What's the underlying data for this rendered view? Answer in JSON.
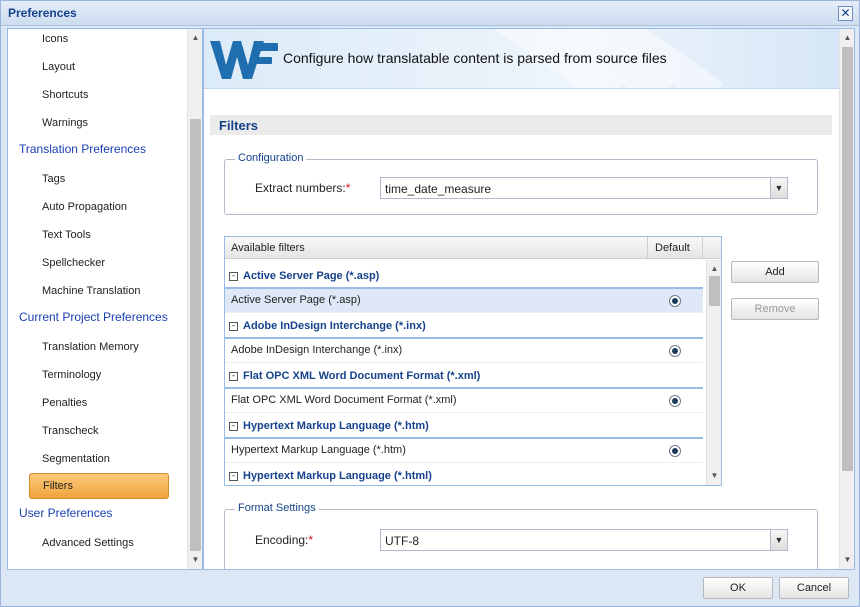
{
  "window": {
    "title": "Preferences"
  },
  "sidebar": {
    "items": [
      {
        "label": "Icons",
        "level": "child"
      },
      {
        "label": "Layout",
        "level": "child"
      },
      {
        "label": "Shortcuts",
        "level": "child"
      },
      {
        "label": "Warnings",
        "level": "child"
      },
      {
        "label": "Translation Preferences",
        "level": "parent"
      },
      {
        "label": "Tags",
        "level": "child"
      },
      {
        "label": "Auto Propagation",
        "level": "child"
      },
      {
        "label": "Text Tools",
        "level": "child"
      },
      {
        "label": "Spellchecker",
        "level": "child"
      },
      {
        "label": "Machine Translation",
        "level": "child"
      },
      {
        "label": "Current Project Preferences",
        "level": "parent"
      },
      {
        "label": "Translation Memory",
        "level": "child"
      },
      {
        "label": "Terminology",
        "level": "child"
      },
      {
        "label": "Penalties",
        "level": "child"
      },
      {
        "label": "Transcheck",
        "level": "child"
      },
      {
        "label": "Segmentation",
        "level": "child"
      },
      {
        "label": "Filters",
        "level": "child",
        "selected": true
      },
      {
        "label": "User Preferences",
        "level": "parent"
      },
      {
        "label": "Advanced Settings",
        "level": "child"
      }
    ]
  },
  "banner": {
    "logo_text": "WF",
    "text": "Configure how translatable content is parsed from source files"
  },
  "section": {
    "title": "Filters"
  },
  "configuration": {
    "legend": "Configuration",
    "extract_label": "Extract numbers:",
    "required_mark": "*",
    "extract_value": "time_date_measure"
  },
  "filters_grid": {
    "col_available": "Available filters",
    "col_default": "Default",
    "groups": [
      {
        "title": "Active Server Page (*.asp)",
        "row": "Active Server Page (*.asp)",
        "selected": true
      },
      {
        "title": "Adobe InDesign Interchange (*.inx)",
        "row": "Adobe InDesign Interchange (*.inx)"
      },
      {
        "title": "Flat OPC XML Word Document Format (*.xml)",
        "row": "Flat OPC XML Word Document Format (*.xml)"
      },
      {
        "title": "Hypertext Markup Language (*.htm)",
        "row": "Hypertext Markup Language (*.htm)"
      },
      {
        "title": "Hypertext Markup Language (*.html)"
      }
    ]
  },
  "buttons": {
    "add": "Add",
    "remove": "Remove",
    "ok": "OK",
    "cancel": "Cancel"
  },
  "format_settings": {
    "legend": "Format Settings",
    "encoding_label": "Encoding:",
    "required_mark": "*",
    "encoding_value": "UTF-8"
  },
  "icons": {
    "close": "close-icon",
    "collapse": "minus-box-icon",
    "dropdown": "chevron-down-icon",
    "scroll_up": "arrow-up-icon",
    "scroll_down": "arrow-down-icon"
  },
  "colors": {
    "accent": "#15428b",
    "link": "#1a3fb3",
    "selection": "#f0a43c",
    "logo": "#1f6fb0"
  }
}
